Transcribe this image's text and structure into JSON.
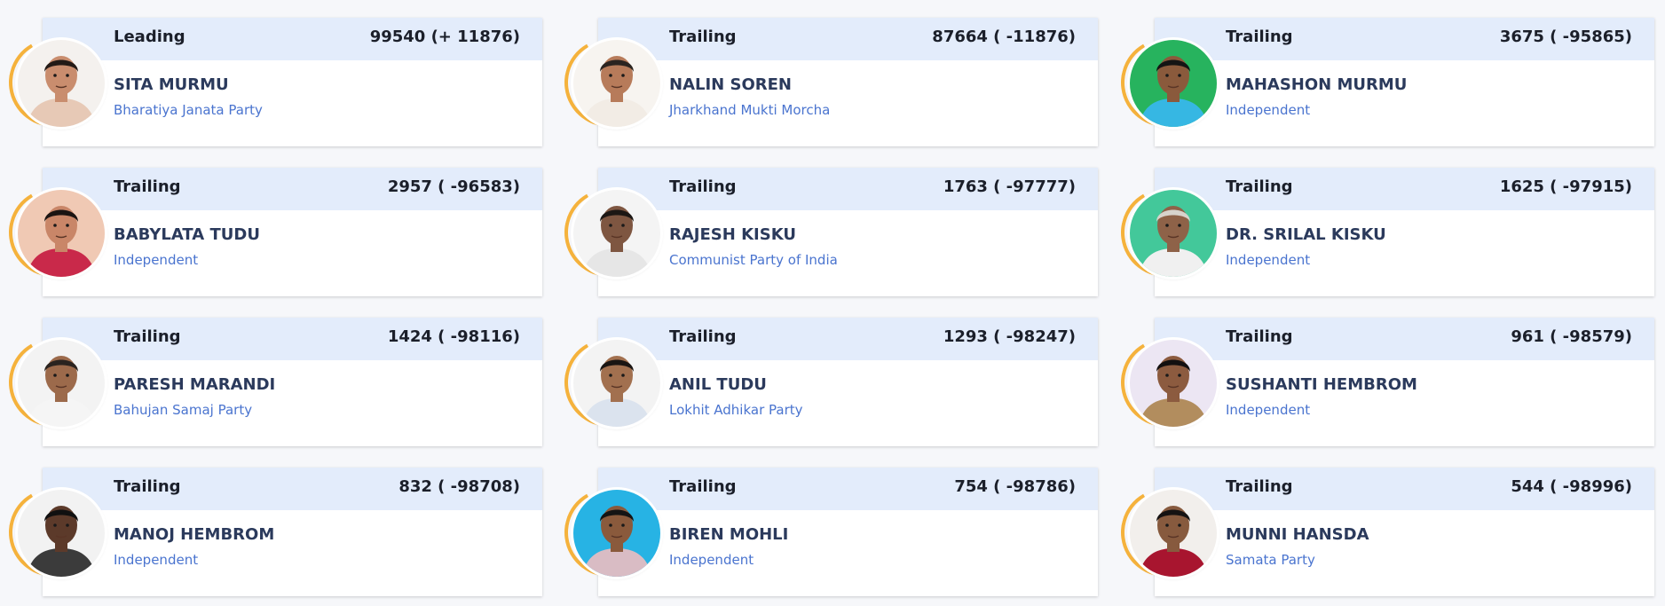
{
  "candidates": [
    {
      "status": "Leading",
      "votes": "99540 (+ 11876)",
      "name": "SITA MURMU",
      "party": "Bharatiya Janata Party",
      "photo_bg": "#f4f1ee",
      "skin": "#c98d6e",
      "hair": "#231a16",
      "cloth": "#e7c9b6"
    },
    {
      "status": "Trailing",
      "votes": "87664 ( -11876)",
      "name": "NALIN SOREN",
      "party": "Jharkhand Mukti Morcha",
      "photo_bg": "#f7f4f0",
      "skin": "#b77b5a",
      "hair": "#2b2420",
      "cloth": "#f2ece5"
    },
    {
      "status": "Trailing",
      "votes": "3675 ( -95865)",
      "name": "MAHASHON MURMU",
      "party": "Independent",
      "photo_bg": "#27b35e",
      "skin": "#8a5a3c",
      "hair": "#141414",
      "cloth": "#36b7e3"
    },
    {
      "status": "Trailing",
      "votes": "2957 ( -96583)",
      "name": "BABYLATA TUDU",
      "party": "Independent",
      "photo_bg": "#f0c9b4",
      "skin": "#c98668",
      "hair": "#1b1412",
      "cloth": "#c9294a"
    },
    {
      "status": "Trailing",
      "votes": "1763 ( -97777)",
      "name": "RAJESH KISKU",
      "party": "Communist Party of India",
      "photo_bg": "#f4f4f4",
      "skin": "#7e5641",
      "hair": "#1c1714",
      "cloth": "#e6e6e6"
    },
    {
      "status": "Trailing",
      "votes": "1625 ( -97915)",
      "name": "DR. SRILAL KISKU",
      "party": "Independent",
      "photo_bg": "#43c89a",
      "skin": "#8e6248",
      "hair": "#d7d3cc",
      "cloth": "#f0f0f0"
    },
    {
      "status": "Trailing",
      "votes": "1424 ( -98116)",
      "name": "PARESH MARANDI",
      "party": "Bahujan Samaj Party",
      "photo_bg": "#f3f3f3",
      "skin": "#9c6a4b",
      "hair": "#2a231f",
      "cloth": "#f5f5f5"
    },
    {
      "status": "Trailing",
      "votes": "1293 ( -98247)",
      "name": "ANIL TUDU",
      "party": "Lokhit Adhikar Party",
      "photo_bg": "#f3f3f3",
      "skin": "#a2704f",
      "hair": "#1a1513",
      "cloth": "#dbe3ee"
    },
    {
      "status": "Trailing",
      "votes": "961 ( -98579)",
      "name": "SUSHANTI HEMBROM",
      "party": "Independent",
      "photo_bg": "#ece6f3",
      "skin": "#8c5b3f",
      "hair": "#131010",
      "cloth": "#b28d5e"
    },
    {
      "status": "Trailing",
      "votes": "832 ( -98708)",
      "name": "MANOJ HEMBROM",
      "party": "Independent",
      "photo_bg": "#f2f2f2",
      "skin": "#5c3a2a",
      "hair": "#101010",
      "cloth": "#3b3b3b"
    },
    {
      "status": "Trailing",
      "votes": "754 ( -98786)",
      "name": "BIREN MOHLI",
      "party": "Independent",
      "photo_bg": "#27b3e4",
      "skin": "#8a5a3c",
      "hair": "#141414",
      "cloth": "#d9bcc4"
    },
    {
      "status": "Trailing",
      "votes": "544 ( -98996)",
      "name": "MUNNI HANSDA",
      "party": "Samata Party",
      "photo_bg": "#f2efec",
      "skin": "#875a3e",
      "hair": "#151212",
      "cloth": "#a8152f"
    }
  ],
  "colors": {
    "header_bg": "#e3ecfb",
    "ring": "#f5b23c",
    "name": "#2b3a5c",
    "party": "#4a74cf"
  }
}
